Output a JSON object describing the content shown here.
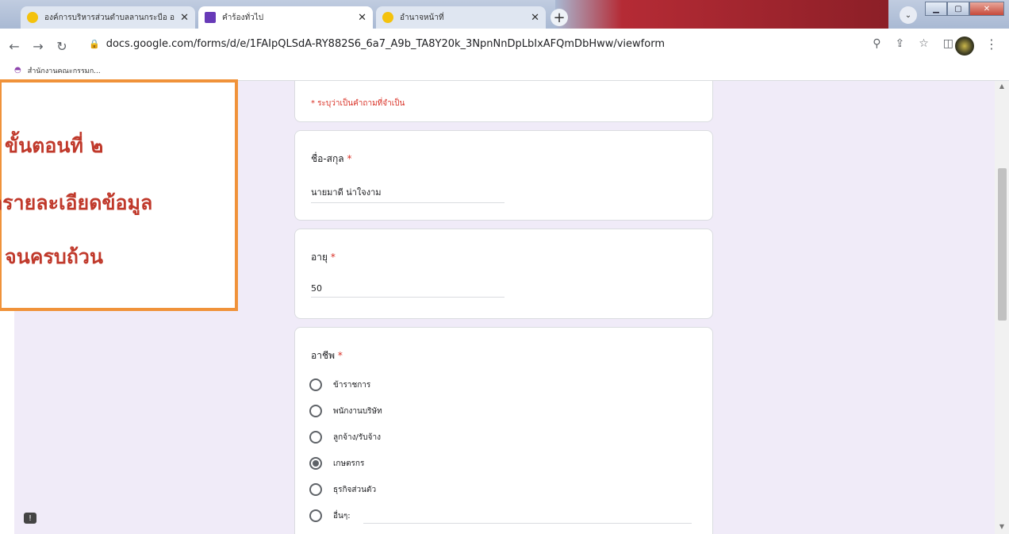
{
  "browser": {
    "tabs": [
      {
        "label": "องค์การบริหารส่วนตำบลลานกระบือ อ.ล",
        "active": false
      },
      {
        "label": "คำร้องทั่วไป",
        "active": true
      },
      {
        "label": "อำนาจหน้าที่",
        "active": false
      }
    ],
    "url": "docs.google.com/forms/d/e/1FAIpQLSdA-RY882S6_6a7_A9b_TA8Y20k_3NpnNnDpLbIxAFQmDbHww/viewform",
    "bookmark": "สำนักงานคณะกรรมก..."
  },
  "form": {
    "required_note": "* ระบุว่าเป็นคำถามที่จำเป็น",
    "questions": {
      "name": {
        "title": "ชื่อ-สกุล",
        "required_mark": "*",
        "value": "นายมาดี  น่าใจงาม"
      },
      "age": {
        "title": "อายุ",
        "required_mark": "*",
        "value": "50"
      },
      "occupation": {
        "title": "อาชีพ",
        "required_mark": "*",
        "options": [
          {
            "label": "ข้าราชการ",
            "selected": false
          },
          {
            "label": "พนักงานบริษัท",
            "selected": false
          },
          {
            "label": "ลูกจ้าง/รับจ้าง",
            "selected": false
          },
          {
            "label": "เกษตรกร",
            "selected": true
          },
          {
            "label": "ธุรกิจส่วนตัว",
            "selected": false
          },
          {
            "label": "อื่นๆ:",
            "selected": false
          }
        ]
      }
    }
  },
  "callout": {
    "line1": "ขั้นตอนที่ ๒",
    "line2": "กรายละเอียดข้อมูล",
    "line3": "จนครบถ้วน"
  },
  "colors": {
    "accent": "#f0923a",
    "callout_text": "#c0392b",
    "required": "#d93025",
    "background": "#f0ebf8"
  }
}
